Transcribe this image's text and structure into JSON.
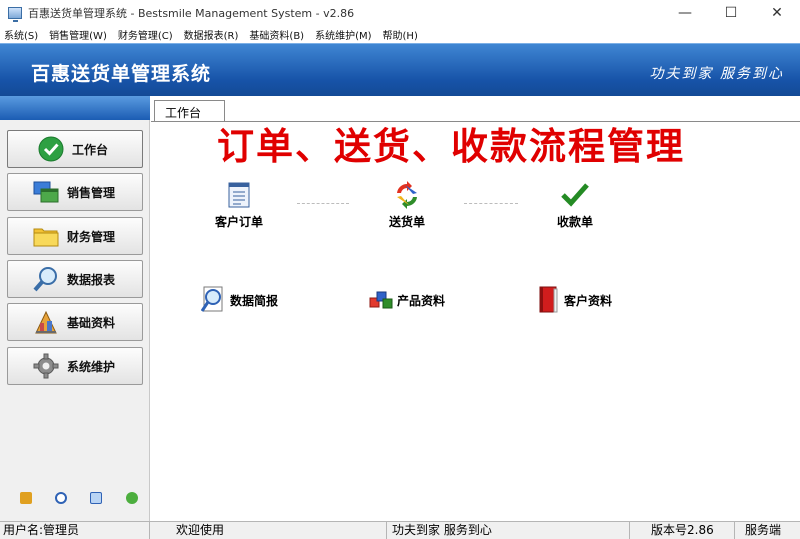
{
  "window": {
    "title": "百惠送货单管理系统 - Bestsmile Management System - v2.86",
    "minimize": "—",
    "maximize": "☐",
    "close": "✕"
  },
  "menu": [
    "系统(S)",
    "销售管理(W)",
    "财务管理(C)",
    "数据报表(R)",
    "基础资料(B)",
    "系统维护(M)",
    "帮助(H)"
  ],
  "banner": {
    "app_name": "百惠送货单管理系统",
    "slogan": "功夫到家 服务到心"
  },
  "nav": [
    {
      "label": "工作台",
      "icon": "check-icon"
    },
    {
      "label": "销售管理",
      "icon": "windows-icon"
    },
    {
      "label": "财务管理",
      "icon": "folder-icon"
    },
    {
      "label": "数据报表",
      "icon": "magnifier-icon"
    },
    {
      "label": "基础资料",
      "icon": "building-icon"
    },
    {
      "label": "系统维护",
      "icon": "gear-icon"
    }
  ],
  "bottom_icons": [
    "key-icon",
    "clock-icon",
    "monitor-icon",
    "refresh-icon"
  ],
  "workbench": {
    "tab_label": "工作台",
    "heading": "订单、送货、收款流程管理",
    "flow": [
      {
        "label": "客户订单",
        "icon": "order-sheet-icon"
      },
      {
        "label": "送货单",
        "icon": "cycle-arrows-icon"
      },
      {
        "label": "收款单",
        "icon": "check-icon"
      }
    ],
    "tools": [
      {
        "label": "数据简报",
        "icon": "report-magnifier-icon"
      },
      {
        "label": "产品资料",
        "icon": "cubes-icon"
      },
      {
        "label": "客户资料",
        "icon": "red-book-icon"
      }
    ]
  },
  "status": {
    "user": "用户名:管理员",
    "welcome": "欢迎使用",
    "slogan": "功夫到家 服务到心",
    "version": "版本号2.86",
    "service": "服务端"
  },
  "colors": {
    "banner": "#1753a8",
    "heading_red": "#e00000"
  }
}
